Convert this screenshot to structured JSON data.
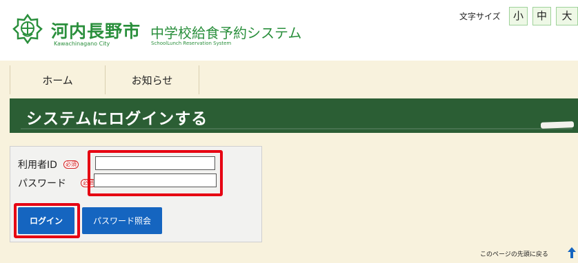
{
  "header": {
    "city_name": "河内長野市",
    "city_roman": "Kawachinagano City",
    "system_name": "中学校給食予約システム",
    "system_roman": "SchoolLunch Reservation System",
    "font_size_label": "文字サイズ",
    "font_sizes": [
      "小",
      "中",
      "大"
    ]
  },
  "nav": {
    "items": [
      "ホーム",
      "お知らせ"
    ]
  },
  "page": {
    "title": "システムにログインする"
  },
  "login": {
    "user_id_label": "利用者ID",
    "password_label": "パスワード",
    "required_badge": "必須",
    "user_id_value": "",
    "password_value": "",
    "login_button": "ログイン",
    "password_inquiry_button": "パスワード照会"
  },
  "footer": {
    "back_to_top": "このページの先頭に戻る"
  },
  "colors": {
    "brand_green": "#2a8f3c",
    "title_bar": "#2b5e34",
    "nav_band": "#f8f2dd",
    "button_blue": "#1565c0",
    "highlight_red": "#e60012"
  },
  "icons": {
    "logo": "city-emblem-icon",
    "back_to_top": "arrow-up-icon"
  }
}
